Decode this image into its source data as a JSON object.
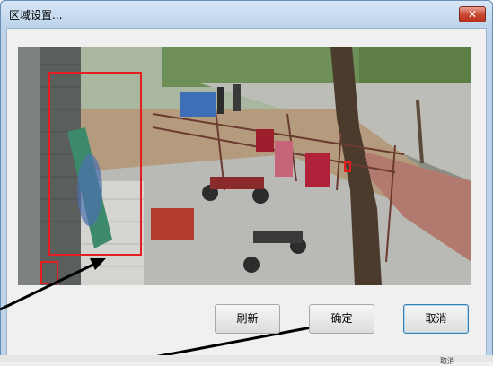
{
  "dialog": {
    "title": "区域设置...",
    "close_label": "✕"
  },
  "buttons": {
    "refresh": "刷新",
    "confirm": "确定",
    "cancel": "取消"
  },
  "bottom_text": "取消",
  "colors": {
    "title_bar": "#bcd3ea",
    "region_box": "#e41e1e",
    "close_button": "#c8462f"
  }
}
